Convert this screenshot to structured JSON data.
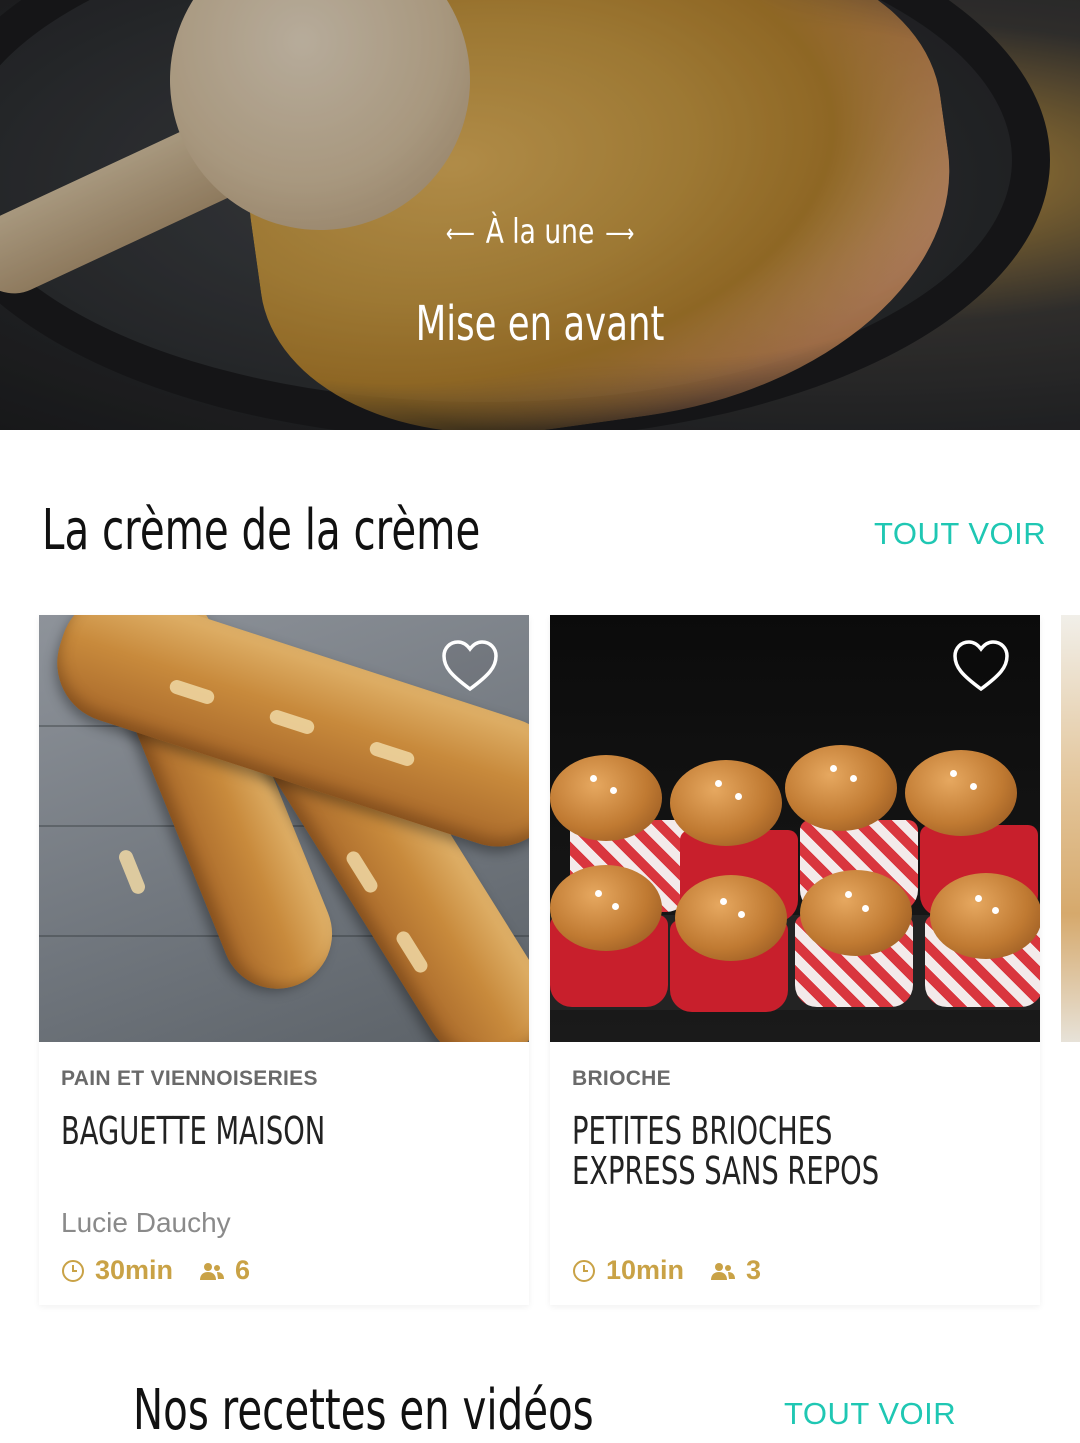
{
  "hero": {
    "kicker": "À la une",
    "kicker_ornament": "~",
    "title": "Mise en avant"
  },
  "section_best": {
    "title": "La crème de la crème",
    "see_all": "TOUT VOIR"
  },
  "cards": [
    {
      "category": "PAIN ET VIENNOISERIES",
      "title": "BAGUETTE MAISON",
      "author": "Lucie Dauchy",
      "time": "30min",
      "servings": "6",
      "image": "baguettes"
    },
    {
      "category": "BRIOCHE",
      "title": "PETITES BRIOCHES EXPRESS SANS REPOS",
      "author": "",
      "time": "10min",
      "servings": "3",
      "image": "brioches"
    }
  ],
  "section_videos": {
    "title": "Nos recettes en vidéos",
    "see_all": "TOUT VOIR"
  },
  "colors": {
    "accent": "#1fc7b3",
    "meta": "#c9a246"
  },
  "icons": [
    "heart-icon",
    "clock-icon",
    "people-icon"
  ]
}
